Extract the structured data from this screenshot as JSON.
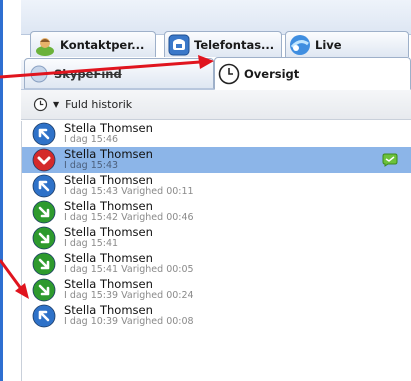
{
  "tabs": [
    {
      "label": "Kontaktper...",
      "icon": "contacts-icon"
    },
    {
      "label": "Telefontas...",
      "icon": "phone-icon"
    },
    {
      "label": "Live",
      "icon": "live-icon"
    },
    {
      "label": "SkypeFind",
      "icon": "skypefind-icon"
    },
    {
      "label": "Oversigt",
      "icon": "clock-icon"
    }
  ],
  "filter": {
    "label": "Fuld historik"
  },
  "history": [
    {
      "name": "Stella Thomsen",
      "detail": "I dag 15:46",
      "type": "outgoing"
    },
    {
      "name": "Stella Thomsen",
      "detail": "I dag 15:43",
      "type": "missed"
    },
    {
      "name": "Stella Thomsen",
      "detail": "I dag 15:43 Varighed 00:11",
      "type": "outgoing"
    },
    {
      "name": "Stella Thomsen",
      "detail": "I dag 15:42 Varighed 00:46",
      "type": "incoming"
    },
    {
      "name": "Stella Thomsen",
      "detail": "I dag 15:41",
      "type": "incoming"
    },
    {
      "name": "Stella Thomsen",
      "detail": "I dag 15:41 Varighed 00:05",
      "type": "incoming"
    },
    {
      "name": "Stella Thomsen",
      "detail": "I dag 15:39 Varighed 00:24",
      "type": "incoming"
    },
    {
      "name": "Stella Thomsen",
      "detail": "I dag 10:39 Varighed 00:08",
      "type": "outgoing"
    }
  ],
  "colors": {
    "outgoing": "#2f72c8",
    "missed": "#d42a2a",
    "incoming": "#2e9a2e",
    "annotation": "#e0141e"
  }
}
